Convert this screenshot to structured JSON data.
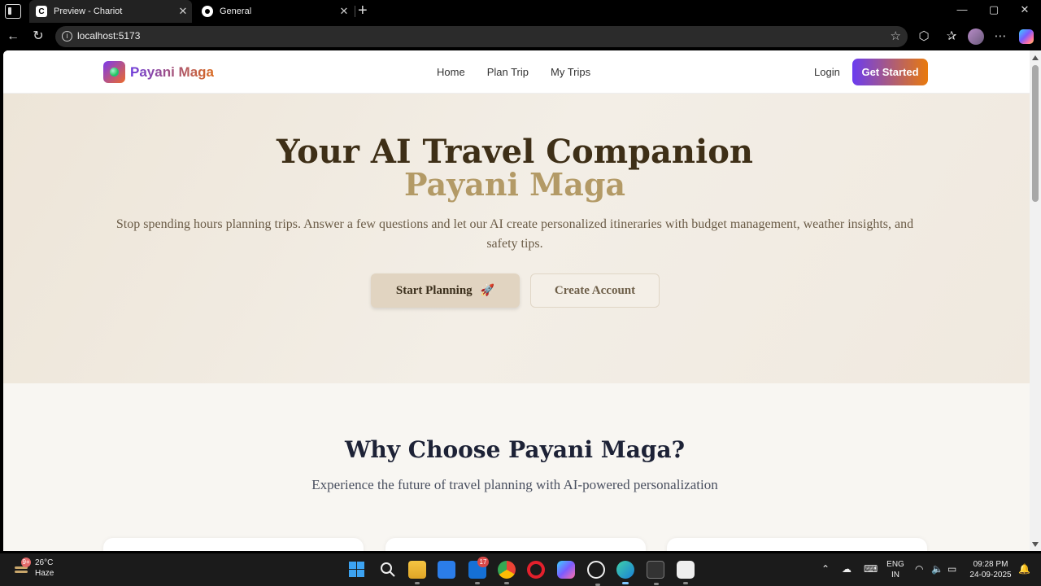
{
  "browser": {
    "tabs": [
      {
        "title": "Preview - Chariot",
        "favicon": "chariot-icon",
        "active": true
      },
      {
        "title": "General",
        "favicon": "github-icon",
        "active": false
      }
    ],
    "url": "localhost:5173"
  },
  "site": {
    "logo_text": "Payani Maga",
    "nav": [
      "Home",
      "Plan Trip",
      "My Trips"
    ],
    "login_label": "Login",
    "cta_label": "Get Started",
    "colors": {
      "brand_start": "#6b3cf0",
      "brand_end": "#e97a0c"
    }
  },
  "hero": {
    "title": "Your AI Travel Companion",
    "subtitle": "Payani Maga",
    "lead": "Stop spending hours planning trips. Answer a few questions and let our AI create personalized itineraries with budget management, weather insights, and safety tips.",
    "primary_button": "Start Planning",
    "primary_icon": "🚀",
    "secondary_button": "Create Account"
  },
  "features": {
    "heading": "Why Choose Payani Maga?",
    "subheading": "Experience the future of travel planning with AI-powered personalization"
  },
  "taskbar": {
    "weather_temp": "26°C",
    "weather_desc": "Haze",
    "weather_badge": "9+",
    "mail_badge": "17",
    "lang_primary": "ENG",
    "lang_secondary": "IN",
    "time": "09:28 PM",
    "date": "24-09-2025"
  }
}
